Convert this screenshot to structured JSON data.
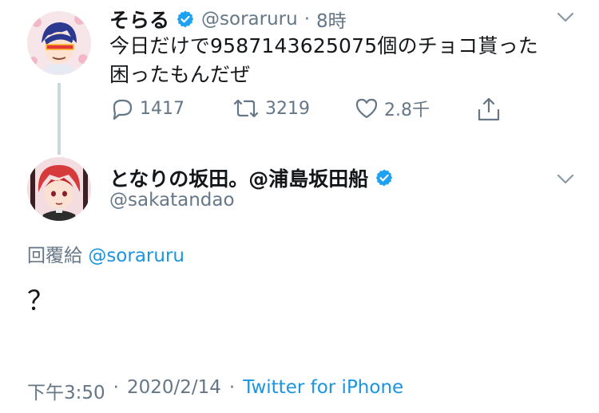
{
  "tweet1": {
    "display_name": "そらる",
    "handle": "@soraruru",
    "separator": "·",
    "time": "8時",
    "text_line1": "今日だけで9587143625075個のチョコ貰った",
    "text_line2": "困ったもんだぜ",
    "replies": "1417",
    "retweets": "3219",
    "likes": "2.8千"
  },
  "tweet2": {
    "display_name": "となりの坂田。@浦島坂田船",
    "handle": "@sakatandao",
    "reply_prefix": "回覆給",
    "reply_mention": "@soraruru",
    "text": "？",
    "time": "下午3:50",
    "dot1": "·",
    "date": "2020/2/14",
    "dot2": "·",
    "source": "Twitter for iPhone"
  },
  "colors": {
    "verified": "#1da1f2",
    "link": "#1b95e0",
    "muted": "#657786",
    "thread_line": "#ccd6dd"
  },
  "icons": [
    "verified-badge-icon",
    "chevron-down-icon",
    "reply-icon",
    "retweet-icon",
    "like-icon",
    "share-icon"
  ]
}
